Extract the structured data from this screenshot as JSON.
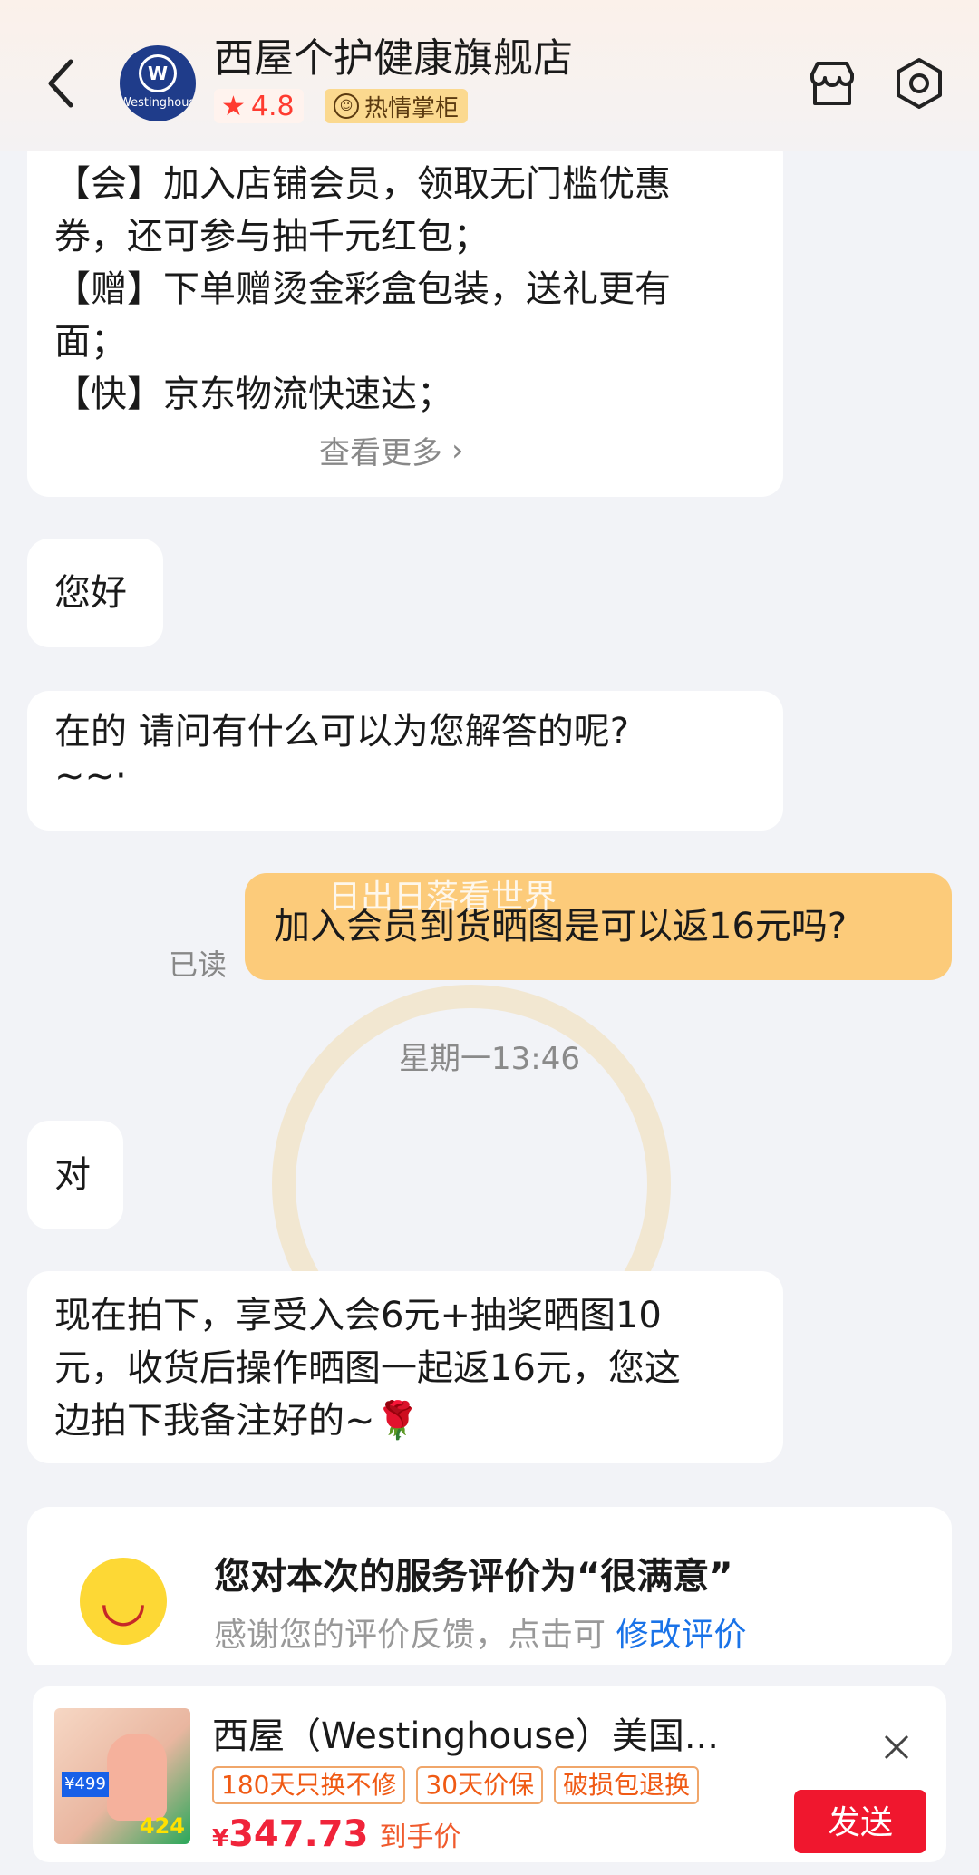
{
  "header": {
    "shop_name": "西屋个护健康旗舰店",
    "avatar_text": "Westinghouse",
    "rating": "4.8",
    "badge": "热情掌柜"
  },
  "messages": {
    "promo_lines": [
      "【会】加入店铺会员，领取无门槛优惠",
      "券，还可参与抽千元红包；",
      "【赠】下单赠烫金彩盒包装，送礼更有",
      "面；",
      "【快】京东物流快速达；"
    ],
    "view_more": "查看更多",
    "hello": "您好",
    "reply1_lines": [
      "在的  请问有什么可以为您解答的呢?",
      "~~·"
    ],
    "my_message": "加入会员到货晒图是可以返16元吗?",
    "my_message_overlay": "日出日落看世界",
    "read_status": "已读",
    "timestamp": "星期一13:46",
    "yes": "对",
    "reply2_lines": [
      "现在拍下，享受入会6元+抽奖晒图10",
      "元，收货后操作晒图一起返16元，您这",
      "边拍下我备注好的~🌹"
    ]
  },
  "rating_card": {
    "title": "您对本次的服务评价为“很满意”",
    "sub": "感谢您的评价反馈，点击可",
    "link": "修改评价"
  },
  "product": {
    "title": "西屋（Westinghouse）美国...",
    "tags": [
      "180天只换不修",
      "30天价保",
      "破损包退换"
    ],
    "currency": "¥",
    "price": "347.73",
    "price_note": "到手价",
    "send": "发送",
    "thumb_badge": "¥499",
    "thumb_price": "424"
  },
  "colors": {
    "accent": "#f0172e",
    "my_bubble": "#fccb7a",
    "link": "#1a73e8"
  }
}
